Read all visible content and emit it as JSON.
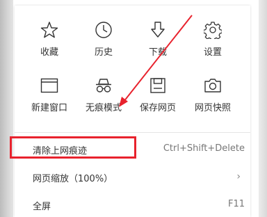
{
  "colors": {
    "annotation": "#e8222d",
    "icon_stroke": "#333333"
  },
  "grid": [
    {
      "label": "收藏",
      "icon": "star-icon"
    },
    {
      "label": "历史",
      "icon": "clock-icon"
    },
    {
      "label": "下载",
      "icon": "download-icon"
    },
    {
      "label": "设置",
      "icon": "gear-icon"
    },
    {
      "label": "新建窗口",
      "icon": "window-icon"
    },
    {
      "label": "无痕模式",
      "icon": "incognito-icon"
    },
    {
      "label": "保存网页",
      "icon": "save-icon"
    },
    {
      "label": "网页快照",
      "icon": "camera-icon"
    }
  ],
  "list": [
    {
      "label": "清除上网痕迹",
      "shortcut": "Ctrl+Shift+Delete"
    },
    {
      "label": "网页缩放（100%）",
      "submenu_icon": "chevron-right-icon"
    },
    {
      "label": "全屏",
      "shortcut": "F11"
    }
  ]
}
